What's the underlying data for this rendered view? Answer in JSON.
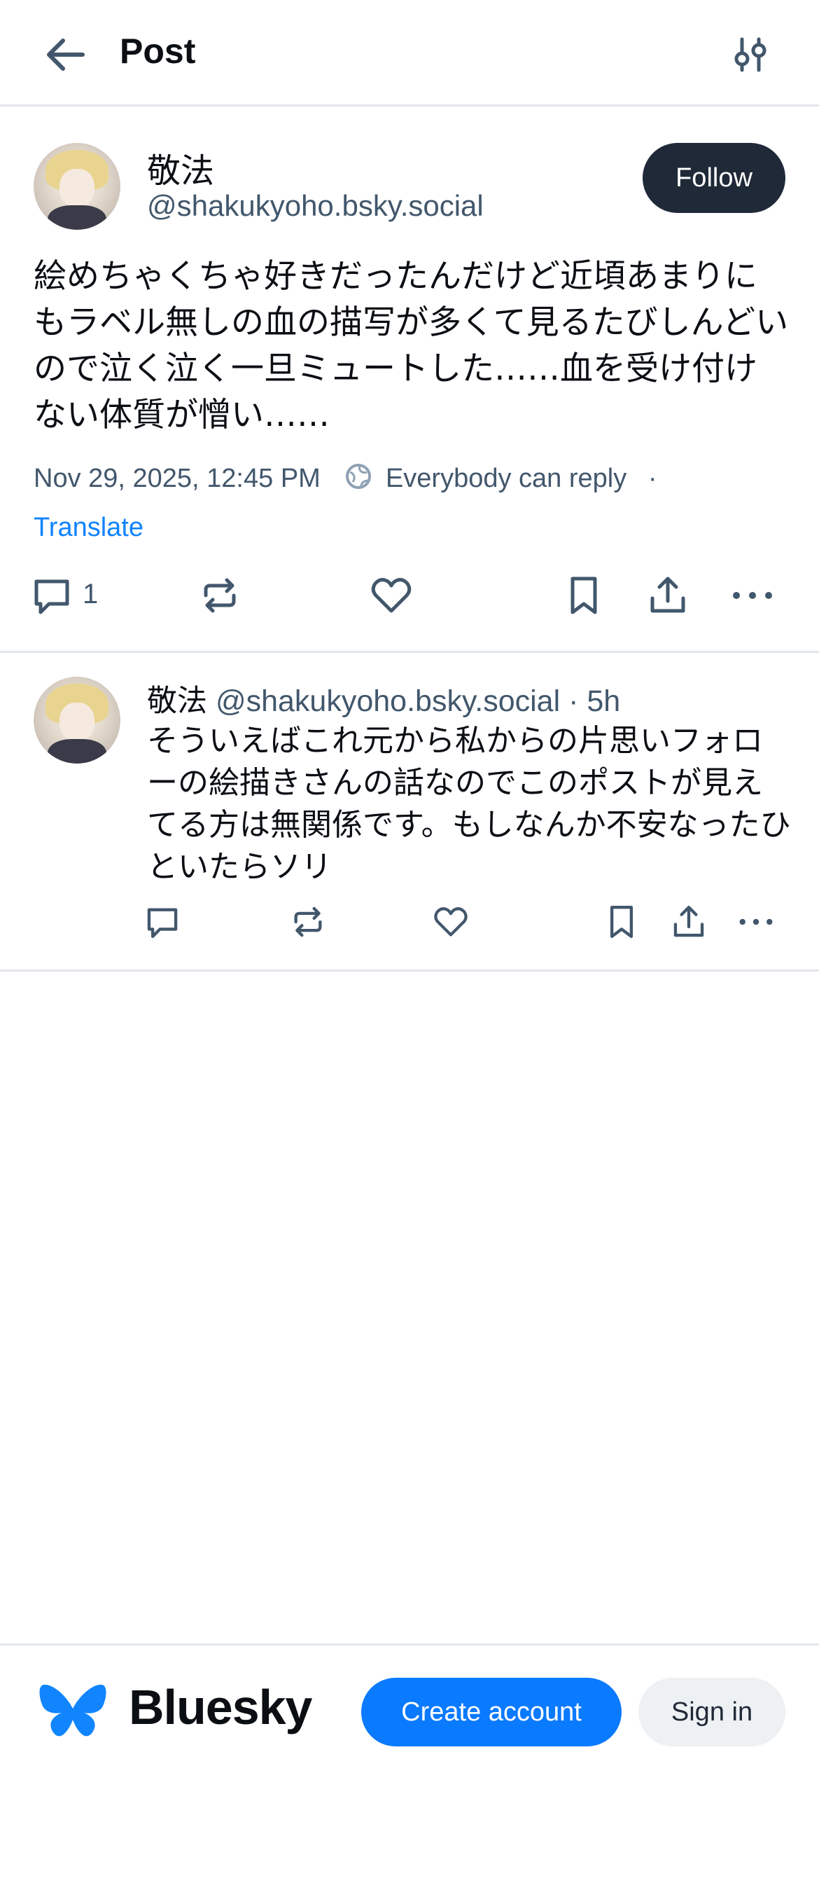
{
  "header": {
    "title": "Post"
  },
  "post": {
    "display_name": "敬法",
    "handle": "@shakukyoho.bsky.social",
    "follow_label": "Follow",
    "text": "絵めちゃくちゃ好きだったんだけど近頃あまりにもラベル無しの血の描写が多くて見るたびしんどいので泣く泣く一旦ミュートした……血を受け付けない体質が憎い……",
    "timestamp": "Nov 29, 2025, 12:45 PM",
    "reply_setting": "Everybody can reply",
    "separator": "·",
    "translate_label": "Translate",
    "reply_count": "1"
  },
  "reply": {
    "display_name": "敬法",
    "handle": "@shakukyoho.bsky.social",
    "separator": "·",
    "age": "5h",
    "text": "そういえばこれ元から私からの片思いフォローの絵描きさんの話なのでこのポストが見えてる方は無関係です。もしなんか不安なったひといたらソリ"
  },
  "footer": {
    "brand": "Bluesky",
    "create_label": "Create account",
    "signin_label": "Sign in"
  },
  "colors": {
    "accent": "#0a7aff",
    "link": "#1083fe",
    "follow_bg": "#1f2937",
    "muted_text": "#42576c",
    "divider": "#e2e6ea"
  },
  "icons": [
    "back-arrow-icon",
    "filter-sliders-icon",
    "globe-icon",
    "comment-icon",
    "repost-icon",
    "like-heart-icon",
    "bookmark-icon",
    "share-icon",
    "more-icon",
    "bluesky-butterfly-icon"
  ]
}
